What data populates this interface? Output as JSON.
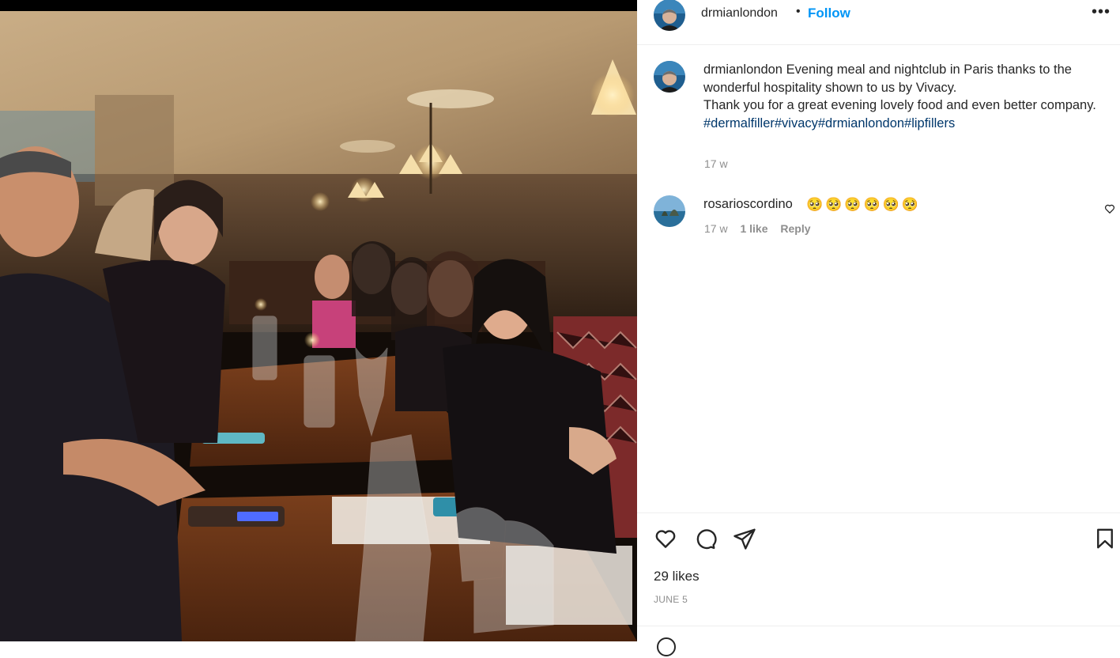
{
  "header": {
    "username": "drmianlondon",
    "separator": "•",
    "follow_label": "Follow",
    "more_label": "•••"
  },
  "caption": {
    "username": "drmianlondon",
    "text_line1": "Evening meal and nightclub in Paris thanks to the wonderful hospitality shown to us by Vivacy.",
    "text_line2": "Thank you for a great evening lovely food and even better company.",
    "hashtags": "#dermalfiller#vivacy#drmianlondon#lipfillers",
    "time": "17 w"
  },
  "comment": {
    "username": "rosarioscordino",
    "text": "🥺🥺🥺🥺🥺🥺",
    "time": "17 w",
    "likes": "1 like",
    "reply_label": "Reply"
  },
  "post": {
    "likes": "29 likes",
    "date": "JUNE 5"
  },
  "colors": {
    "follow": "#0095f6",
    "hashtag": "#00376b",
    "muted": "#8e8e8e"
  },
  "icons": [
    "more-icon",
    "heart-icon",
    "comment-icon",
    "share-icon",
    "bookmark-icon",
    "comment-heart-icon"
  ]
}
